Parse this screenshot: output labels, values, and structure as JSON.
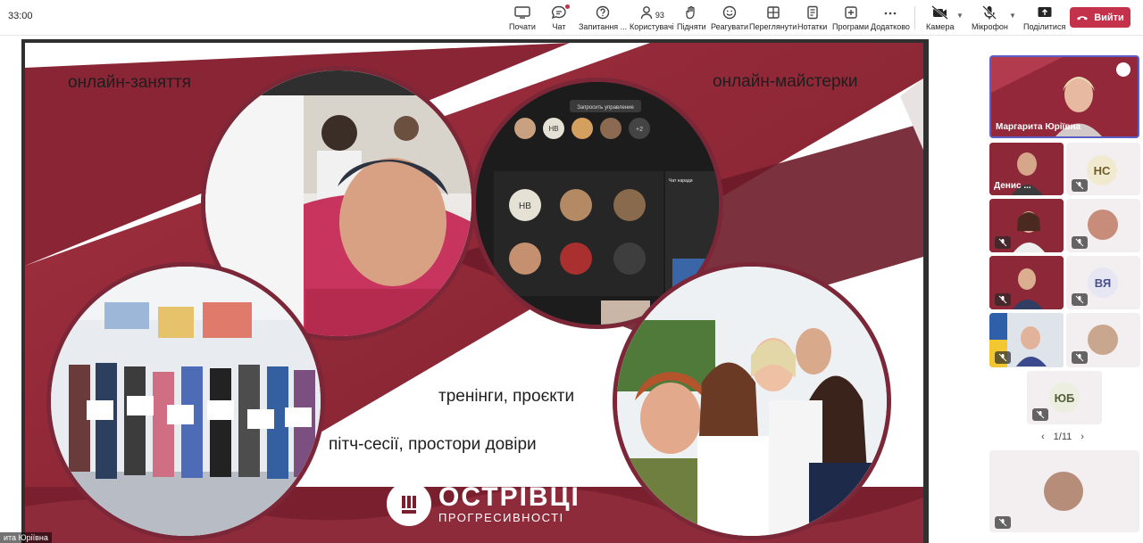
{
  "app": {
    "timer": "33:00"
  },
  "toolbar": {
    "start": "Почати",
    "chat": "Чат",
    "qa": "Запитання ...",
    "people": "Користувачі",
    "people_count": "93",
    "raise": "Підняти",
    "react": "Реагувати",
    "view": "Переглянути",
    "notes": "Нотатки",
    "apps": "Програми",
    "more": "Додатково",
    "camera": "Камера",
    "mic": "Мікрофон",
    "share": "Поділитися",
    "leave": "Вийти"
  },
  "slide": {
    "captions": {
      "online_classes": "онлайн-заняття",
      "online_workshops": "онлайн-майстерки",
      "trainings": "тренінги, проєкти",
      "pitch": "пітч-сесії, простори довіри"
    },
    "brand": {
      "line1": "ОСТРІВЦІ",
      "line2": "ПРОГРЕСИВНОСТІ"
    },
    "inner_meeting": {
      "button": "Запросить управление",
      "avatars": [
        "НВ",
        "+2"
      ],
      "grid_avatar": "НВ",
      "chat_title": "Чат наради"
    },
    "presenter_name": "ита Юріївна"
  },
  "participants": {
    "self": {
      "name": "Маргарита Юріївна"
    },
    "tiles": [
      {
        "name": "Денис ...",
        "type": "video"
      },
      {
        "initials": "НС",
        "type": "avatar"
      },
      {
        "type": "video"
      },
      {
        "type": "photo"
      },
      {
        "type": "video"
      },
      {
        "initials": "ВЯ",
        "type": "avatar"
      },
      {
        "type": "video"
      },
      {
        "type": "photo"
      },
      {
        "initials": "ЮБ",
        "type": "avatar"
      }
    ],
    "pager": "1/11"
  },
  "colors": {
    "accent": "#5b5fc7",
    "leave": "#c4314b",
    "brand": "#7b2738"
  }
}
